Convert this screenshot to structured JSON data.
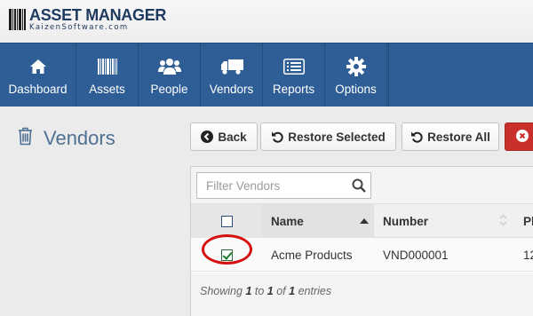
{
  "app": {
    "logo_title": "ASSET MANAGER",
    "logo_subtitle": "KaizenSoftware.com"
  },
  "nav": {
    "items": [
      {
        "label": "Dashboard",
        "icon": "home-icon"
      },
      {
        "label": "Assets",
        "icon": "barcode-icon"
      },
      {
        "label": "People",
        "icon": "people-icon"
      },
      {
        "label": "Vendors",
        "icon": "truck-icon"
      },
      {
        "label": "Reports",
        "icon": "list-icon"
      },
      {
        "label": "Options",
        "icon": "gear-icon"
      }
    ]
  },
  "page": {
    "title": "Vendors",
    "title_icon": "trash-icon"
  },
  "toolbar": {
    "back_label": "Back",
    "restore_selected_label": "Restore Selected",
    "restore_all_label": "Restore All"
  },
  "grid": {
    "filter_placeholder": "Filter Vendors",
    "columns": [
      "Name",
      "Number",
      "Ph"
    ],
    "rows": [
      {
        "selected": true,
        "name": "Acme Products",
        "number": "VND000001",
        "phone": "12"
      }
    ],
    "info": {
      "prefix": "Showing",
      "from": "1",
      "to_word": "to",
      "to": "1",
      "of_word": "of",
      "total": "1",
      "suffix": "entries"
    }
  },
  "colors": {
    "navbar": "#2e5e95",
    "danger": "#c9302c",
    "title": "#4f6f93"
  }
}
